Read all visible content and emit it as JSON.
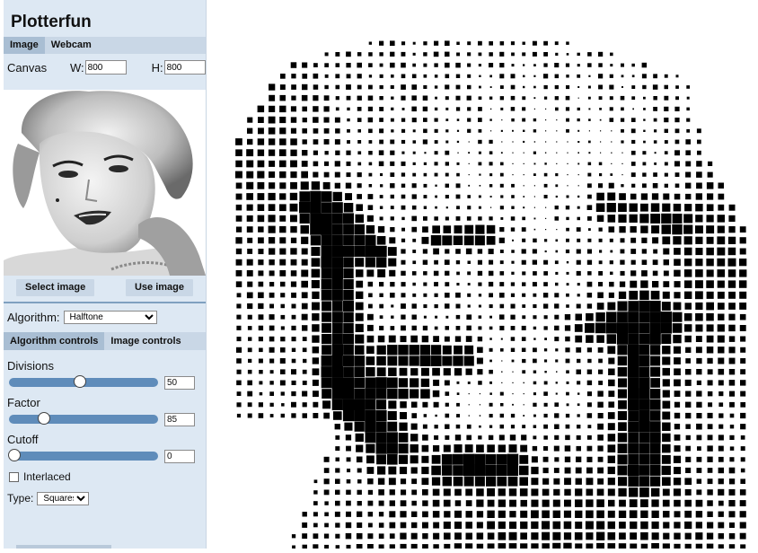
{
  "app": {
    "title": "Plotterfun"
  },
  "source_tabs": [
    {
      "label": "Image",
      "active": true
    },
    {
      "label": "Webcam",
      "active": false
    }
  ],
  "canvas": {
    "label": "Canvas",
    "w_label": "W:",
    "w_value": "800",
    "h_label": "H:",
    "h_value": "800"
  },
  "buttons": {
    "select": "Select image",
    "use": "Use image"
  },
  "algorithm": {
    "label": "Algorithm:",
    "selected": "Halftone"
  },
  "control_tabs": [
    {
      "label": "Algorithm controls",
      "active": true
    },
    {
      "label": "Image controls",
      "active": false
    }
  ],
  "controls": {
    "divisions": {
      "label": "Divisions",
      "value": "50",
      "fraction": 0.44
    },
    "factor": {
      "label": "Factor",
      "value": "85",
      "fraction": 0.2
    },
    "cutoff": {
      "label": "Cutoff",
      "value": "0",
      "fraction": 0.0
    },
    "interlaced": {
      "label": "Interlaced",
      "checked": false
    },
    "type": {
      "label": "Type:",
      "selected": "Squares"
    }
  },
  "colors": {
    "sidebar": "#dde8f3",
    "tab_active": "#a9bed3",
    "slider_track": "#5f8cba",
    "ink": "#000000"
  },
  "icons": {
    "checkbox": "checkbox-icon",
    "dropdown": "chevron-down-icon",
    "slider_thumb": "slider-thumb-icon"
  }
}
